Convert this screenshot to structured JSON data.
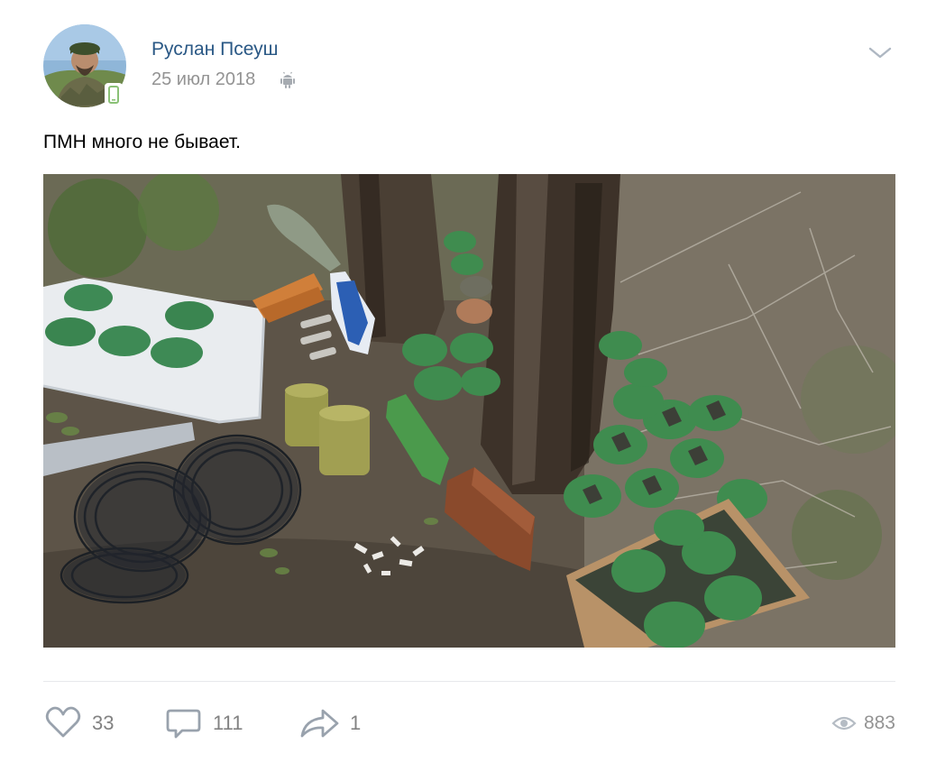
{
  "post": {
    "author_name": "Руслан Псеуш",
    "date": "25 июл 2018",
    "platform_icon": "android-icon",
    "text": "ПМН много не бывает.",
    "photo_alt": "photo",
    "menu_icon": "chevron-down-icon"
  },
  "actions": {
    "likes": {
      "icon": "heart-icon",
      "count": "33"
    },
    "comments": {
      "icon": "comment-icon",
      "count": "111"
    },
    "reposts": {
      "icon": "share-arrow-icon",
      "count": "1"
    },
    "views": {
      "icon": "eye-icon",
      "count": "883"
    }
  },
  "colors": {
    "author_link": "#2a5885",
    "secondary_text": "#939393",
    "action_icon": "#99a2ad",
    "divider": "#e7e8ec"
  }
}
